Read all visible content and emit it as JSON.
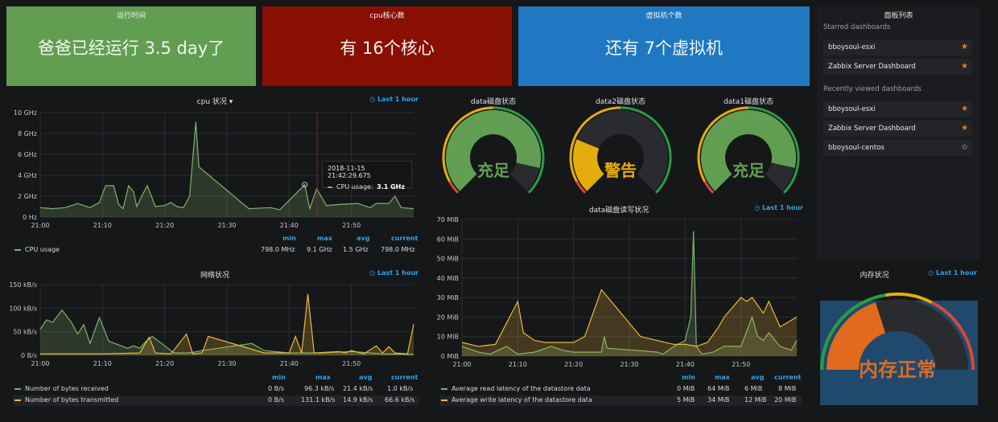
{
  "stats": [
    {
      "title": "运行时间",
      "value": "爸爸已经运行  3.5 day了",
      "color": "#629e51"
    },
    {
      "title": "cpu核心数",
      "value": "有  16个核心",
      "color": "#890f02"
    },
    {
      "title": "虚拟机个数",
      "value": "还有  7个虚拟机",
      "color": "#1f78c1"
    }
  ],
  "dashboards": {
    "title": "面板列表",
    "starred_heading": "Starred dashboards",
    "starred": [
      {
        "name": "bboysoul-esxi",
        "starred": true
      },
      {
        "name": "Zabbix Server Dashboard",
        "starred": true
      }
    ],
    "recent_heading": "Recently viewed dashboards",
    "recent": [
      {
        "name": "bboysoul-esxi",
        "starred": true
      },
      {
        "name": "Zabbix Server Dashboard",
        "starred": true
      },
      {
        "name": "bboysoul-centos",
        "starred": false
      }
    ]
  },
  "time_range": "Last 1 hour",
  "gauges": [
    {
      "title": "data磁盘状态",
      "text": "充足",
      "level": 0.88,
      "color": "#629e51",
      "textcolor": "#629e51"
    },
    {
      "title": "data2磁盘状态",
      "text": "警告",
      "level": 0.25,
      "color": "#e5ac0e",
      "textcolor": "#e5ac0e"
    },
    {
      "title": "data1磁盘状态",
      "text": "充足",
      "level": 0.88,
      "color": "#629e51",
      "textcolor": "#629e51"
    }
  ],
  "memory": {
    "title": "内存状况",
    "text": "内存正常",
    "level": 0.4
  },
  "legend_heads": {
    "min": "min",
    "max": "max",
    "avg": "avg",
    "current": "current"
  },
  "tooltip": {
    "time": "2018-11-15 21:42:29.675",
    "label": "CPU usage:",
    "value": "3.1 GHz"
  },
  "chart_data": [
    {
      "type": "line",
      "title": "cpu 状况",
      "x_ticks": [
        "21:00",
        "21:10",
        "21:20",
        "21:30",
        "21:40",
        "21:50"
      ],
      "y_ticks": [
        "0 Hz",
        "2 GHz",
        "4 GHz",
        "6 GHz",
        "8 GHz",
        "10 GHz"
      ],
      "ylim": [
        0,
        10
      ],
      "xlim": [
        0,
        60
      ],
      "series": [
        {
          "name": "CPU usage",
          "color": "#7eb26d",
          "min": "798.0 MHz",
          "max": "9.1 GHz",
          "avg": "1.5 GHz",
          "current": "798.0 MHz",
          "points": [
            [
              0,
              0.9
            ],
            [
              2,
              0.8
            ],
            [
              4,
              0.9
            ],
            [
              6,
              1.3
            ],
            [
              8,
              0.9
            ],
            [
              9.5,
              1.4
            ],
            [
              10.5,
              3.0
            ],
            [
              11.8,
              3.0
            ],
            [
              12.6,
              1.2
            ],
            [
              13.3,
              0.8
            ],
            [
              14.2,
              3.0
            ],
            [
              15,
              2.4
            ],
            [
              15.5,
              1.0
            ],
            [
              16.3,
              2.0
            ],
            [
              17.2,
              3.0
            ],
            [
              18.5,
              1.0
            ],
            [
              20,
              1.1
            ],
            [
              21,
              1.4
            ],
            [
              22,
              1.0
            ],
            [
              23,
              0.9
            ],
            [
              24,
              2.0
            ],
            [
              25,
              9.1
            ],
            [
              25.5,
              4.8
            ],
            [
              33.5,
              0.8
            ],
            [
              37,
              0.9
            ],
            [
              38.5,
              0.7
            ],
            [
              42.5,
              3.1
            ],
            [
              43.3,
              0.8
            ],
            [
              44.4,
              2.7
            ],
            [
              46,
              1.1
            ],
            [
              48,
              1.2
            ],
            [
              51,
              1.3
            ],
            [
              53,
              0.9
            ],
            [
              54,
              1.3
            ],
            [
              56,
              1.3
            ],
            [
              57,
              2.0
            ],
            [
              58,
              0.9
            ],
            [
              60,
              0.8
            ]
          ]
        }
      ]
    },
    {
      "type": "line",
      "title": "网络状况",
      "x_ticks": [
        "21:00",
        "21:10",
        "21:20",
        "21:30",
        "21:40",
        "21:50"
      ],
      "y_ticks": [
        "0 B/s",
        "50 kB/s",
        "100 kB/s",
        "150 kB/s"
      ],
      "ylim": [
        0,
        150
      ],
      "xlim": [
        0,
        60
      ],
      "series": [
        {
          "name": "Number of bytes received",
          "color": "#7eb26d",
          "min": "0 B/s",
          "max": "96.3 kB/s",
          "avg": "21.4 kB/s",
          "current": "1.0 kB/s",
          "points": [
            [
              0,
              55
            ],
            [
              1,
              75
            ],
            [
              2,
              70
            ],
            [
              3.5,
              96
            ],
            [
              5,
              70
            ],
            [
              6,
              45
            ],
            [
              7,
              65
            ],
            [
              8,
              25
            ],
            [
              9.5,
              80
            ],
            [
              11,
              30
            ],
            [
              12,
              25
            ],
            [
              14,
              15
            ],
            [
              15,
              20
            ],
            [
              16,
              15
            ],
            [
              17,
              30
            ],
            [
              18,
              40
            ],
            [
              20,
              20
            ],
            [
              21.5,
              5
            ],
            [
              24,
              5
            ],
            [
              26,
              10
            ],
            [
              34,
              25
            ],
            [
              36,
              10
            ],
            [
              40,
              5
            ],
            [
              45,
              5
            ],
            [
              50,
              8
            ],
            [
              55,
              3
            ],
            [
              60,
              2
            ]
          ]
        },
        {
          "name": "Number of bytes transmitted",
          "color": "#eab839",
          "min": "0 B/s",
          "max": "131.1 kB/s",
          "avg": "14.9 kB/s",
          "current": "66.6 kB/s",
          "points": [
            [
              0,
              3
            ],
            [
              10,
              3
            ],
            [
              16,
              5
            ],
            [
              17.5,
              38
            ],
            [
              18.5,
              5
            ],
            [
              21,
              3
            ],
            [
              23.5,
              45
            ],
            [
              24.5,
              3
            ],
            [
              26,
              5
            ],
            [
              27,
              40
            ],
            [
              36,
              5
            ],
            [
              40,
              5
            ],
            [
              41,
              40
            ],
            [
              42,
              5
            ],
            [
              43,
              130
            ],
            [
              44,
              5
            ],
            [
              48,
              8
            ],
            [
              49,
              5
            ],
            [
              50,
              10
            ],
            [
              52,
              3
            ],
            [
              54,
              20
            ],
            [
              55,
              5
            ],
            [
              56,
              18
            ],
            [
              57,
              5
            ],
            [
              59,
              3
            ],
            [
              60,
              66
            ]
          ]
        }
      ]
    },
    {
      "type": "line",
      "title": "data磁盘读写状况",
      "x_ticks": [
        "21:00",
        "21:10",
        "21:20",
        "21:30",
        "21:40",
        "21:50"
      ],
      "y_ticks": [
        "0 MiB",
        "10 MiB",
        "20 MiB",
        "30 MiB",
        "40 MiB",
        "50 MiB",
        "60 MiB",
        "70 MiB"
      ],
      "ylim": [
        0,
        70
      ],
      "xlim": [
        0,
        60
      ],
      "series": [
        {
          "name": "Average read latency of the datastore data",
          "color": "#7eb26d",
          "min": "0 MiB",
          "max": "64 MiB",
          "avg": "6 MiB",
          "current": "8 MiB",
          "points": [
            [
              0,
              5
            ],
            [
              3,
              2
            ],
            [
              5,
              1
            ],
            [
              8,
              5
            ],
            [
              10,
              1
            ],
            [
              13,
              2
            ],
            [
              16,
              5
            ],
            [
              18,
              3
            ],
            [
              20,
              2
            ],
            [
              25,
              2
            ],
            [
              25.5,
              10
            ],
            [
              26,
              4
            ],
            [
              31,
              3
            ],
            [
              35,
              2
            ],
            [
              36,
              1
            ],
            [
              38,
              5
            ],
            [
              40,
              8
            ],
            [
              41,
              20
            ],
            [
              41.5,
              64
            ],
            [
              42,
              5
            ],
            [
              43,
              1
            ],
            [
              45,
              2
            ],
            [
              47,
              5
            ],
            [
              50,
              5
            ],
            [
              52,
              20
            ],
            [
              53,
              10
            ],
            [
              54,
              8
            ],
            [
              55,
              12
            ],
            [
              57,
              5
            ],
            [
              59,
              3
            ],
            [
              60,
              8
            ]
          ]
        },
        {
          "name": "Average write latency of the datastore data",
          "color": "#eab839",
          "min": "5 MiB",
          "max": "34 MiB",
          "avg": "12 MiB",
          "current": "20 MiB",
          "points": [
            [
              0,
              7
            ],
            [
              3,
              5
            ],
            [
              6,
              6
            ],
            [
              10,
              28
            ],
            [
              11,
              12
            ],
            [
              13,
              8
            ],
            [
              15,
              7
            ],
            [
              20,
              7
            ],
            [
              22,
              10
            ],
            [
              25,
              34
            ],
            [
              32,
              10
            ],
            [
              35,
              8
            ],
            [
              38,
              6
            ],
            [
              40,
              6
            ],
            [
              42,
              5
            ],
            [
              44,
              7
            ],
            [
              46,
              15
            ],
            [
              47,
              20
            ],
            [
              50,
              30
            ],
            [
              51,
              28
            ],
            [
              52,
              30
            ],
            [
              54,
              22
            ],
            [
              55,
              28
            ],
            [
              57,
              15
            ],
            [
              60,
              20
            ]
          ]
        }
      ]
    }
  ]
}
